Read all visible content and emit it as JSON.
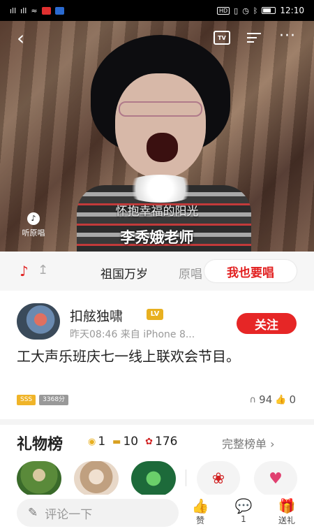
{
  "status_bar": {
    "left_icons": [
      "signal-icon",
      "signal-icon",
      "wifi-icon",
      "app-notification-icon",
      "message-icon"
    ],
    "right_icons": [
      "hd-icon",
      "vibrate-icon",
      "alarm-icon",
      "bluetooth-icon",
      "battery-icon"
    ],
    "hd_label": "HD",
    "time": "12:10"
  },
  "video": {
    "lyric_line": "怀抱幸福的阳光",
    "caption": "李秀娥老师",
    "original_vocal_label": "听原唱",
    "tv_label": "TV"
  },
  "song": {
    "title": "祖国万岁",
    "original_label": "原唱",
    "sing_button": "我也要唱"
  },
  "user": {
    "name": "扣舷独啸",
    "badge": "LV",
    "meta": "昨天08:46 来自 iPhone 8...",
    "follow_button": "关注"
  },
  "post": {
    "description": "工大声乐班庆七一线上联欢会节目。",
    "tags": [
      "SSS",
      "3368分"
    ],
    "listens": "94",
    "likes": "0"
  },
  "gifts": {
    "title": "礼物榜",
    "coins": "1",
    "cards": "10",
    "flowers": "176",
    "full_rank_link": "完整榜单 ›"
  },
  "bottom_bar": {
    "comment_placeholder": "评论一下",
    "like_label": "赞",
    "wechat_count": "1",
    "gift_label": "送礼"
  },
  "colors": {
    "accent_red": "#e62626",
    "badge_gold": "#f0b428"
  }
}
